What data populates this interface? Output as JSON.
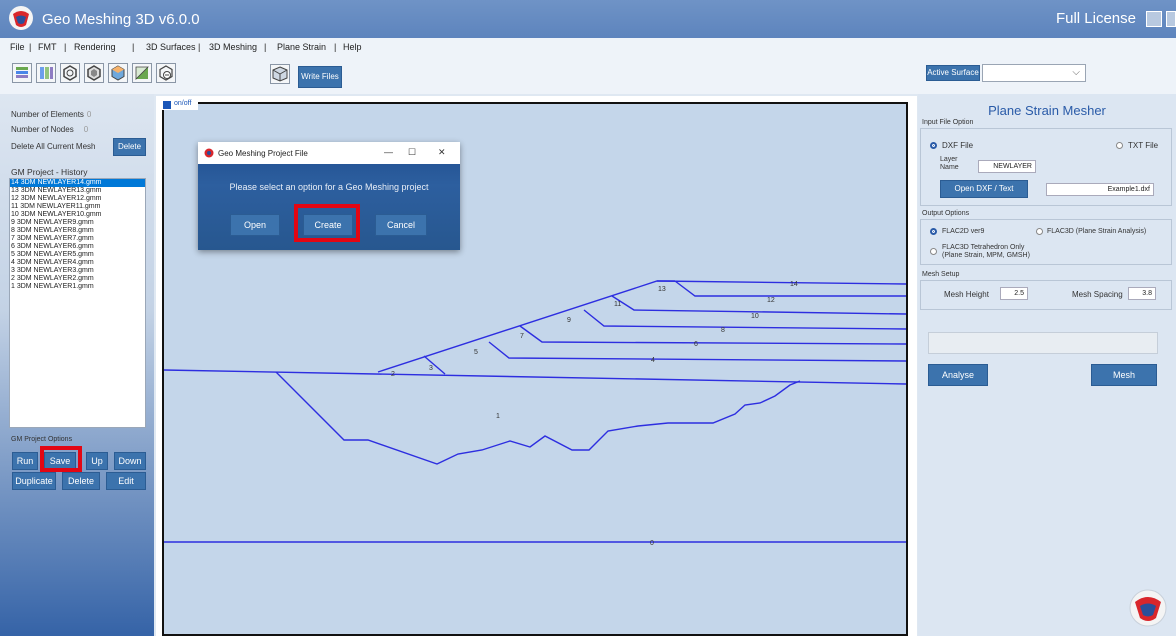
{
  "app": {
    "title": "Geo Meshing 3D v6.0.0",
    "license": "Full License"
  },
  "menu": [
    "File",
    "|",
    "FMT",
    "|",
    "Rendering",
    "|",
    "3D Surfaces",
    "|",
    "3D Meshing",
    "|",
    "Plane Strain",
    "|",
    "Help"
  ],
  "toolbar": {
    "write_files": "Write Files",
    "active_surface": "Active Surface",
    "surface_value": ""
  },
  "left": {
    "num_elements_label": "Number of Elements",
    "num_elements": "0",
    "num_nodes_label": "Number of Nodes",
    "num_nodes": "0",
    "delete_all_label": "Delete All Current Mesh",
    "delete_btn": "Delete",
    "history_label": "GM Project - History",
    "history": [
      "14 3DM NEWLAYER14.gmm",
      "13 3DM NEWLAYER13.gmm",
      "12 3DM NEWLAYER12.gmm",
      "11 3DM NEWLAYER11.gmm",
      "10 3DM NEWLAYER10.gmm",
      "9 3DM NEWLAYER9.gmm",
      "8 3DM NEWLAYER8.gmm",
      "7 3DM NEWLAYER7.gmm",
      "6 3DM NEWLAYER6.gmm",
      "5 3DM NEWLAYER5.gmm",
      "4 3DM NEWLAYER4.gmm",
      "3 3DM NEWLAYER3.gmm",
      "2 3DM NEWLAYER2.gmm",
      "1 3DM NEWLAYER1.gmm"
    ],
    "options_label": "GM Project Options",
    "buttons": {
      "run": "Run",
      "save": "Save",
      "up": "Up",
      "down": "Down",
      "duplicate": "Duplicate",
      "delete": "Delete",
      "edit": "Edit"
    }
  },
  "canvas": {
    "onoff": "on/off",
    "labels": [
      "1",
      "2",
      "3",
      "4",
      "5",
      "6",
      "7",
      "8",
      "9",
      "10",
      "11",
      "12",
      "13",
      "14",
      "0"
    ]
  },
  "dialog": {
    "title": "Geo Meshing Project File",
    "message": "Please select an option for a Geo Meshing project",
    "open": "Open",
    "create": "Create",
    "cancel": "Cancel",
    "minimize": "—",
    "maximize": "☐",
    "close": "✕"
  },
  "right": {
    "title": "Plane Strain Mesher",
    "input_group": "Input File Option",
    "dxf": "DXF File",
    "txt": "TXT File",
    "layer_label": "Layer Name",
    "layer_value": "NEWLAYER",
    "open_btn": "Open DXF / Text",
    "file_value": "Example1.dxf",
    "output_group": "Output Options",
    "flac2d": "FLAC2D ver9",
    "flac3d_ps": "FLAC3D (Plane Strain Analysis)",
    "flac3d_tet": "FLAC3D Tetrahedron Only",
    "flac3d_tet_sub": "(Plane Strain, MPM, GMSH)",
    "mesh_group": "Mesh Setup",
    "mesh_height_label": "Mesh Height",
    "mesh_height": "2.5",
    "mesh_spacing_label": "Mesh Spacing",
    "mesh_spacing": "3.8",
    "analyse": "Analyse",
    "mesh": "Mesh"
  },
  "colors": {
    "accent": "#3c73ad",
    "highlight": "#e30613",
    "line": "#2d2ee0"
  }
}
